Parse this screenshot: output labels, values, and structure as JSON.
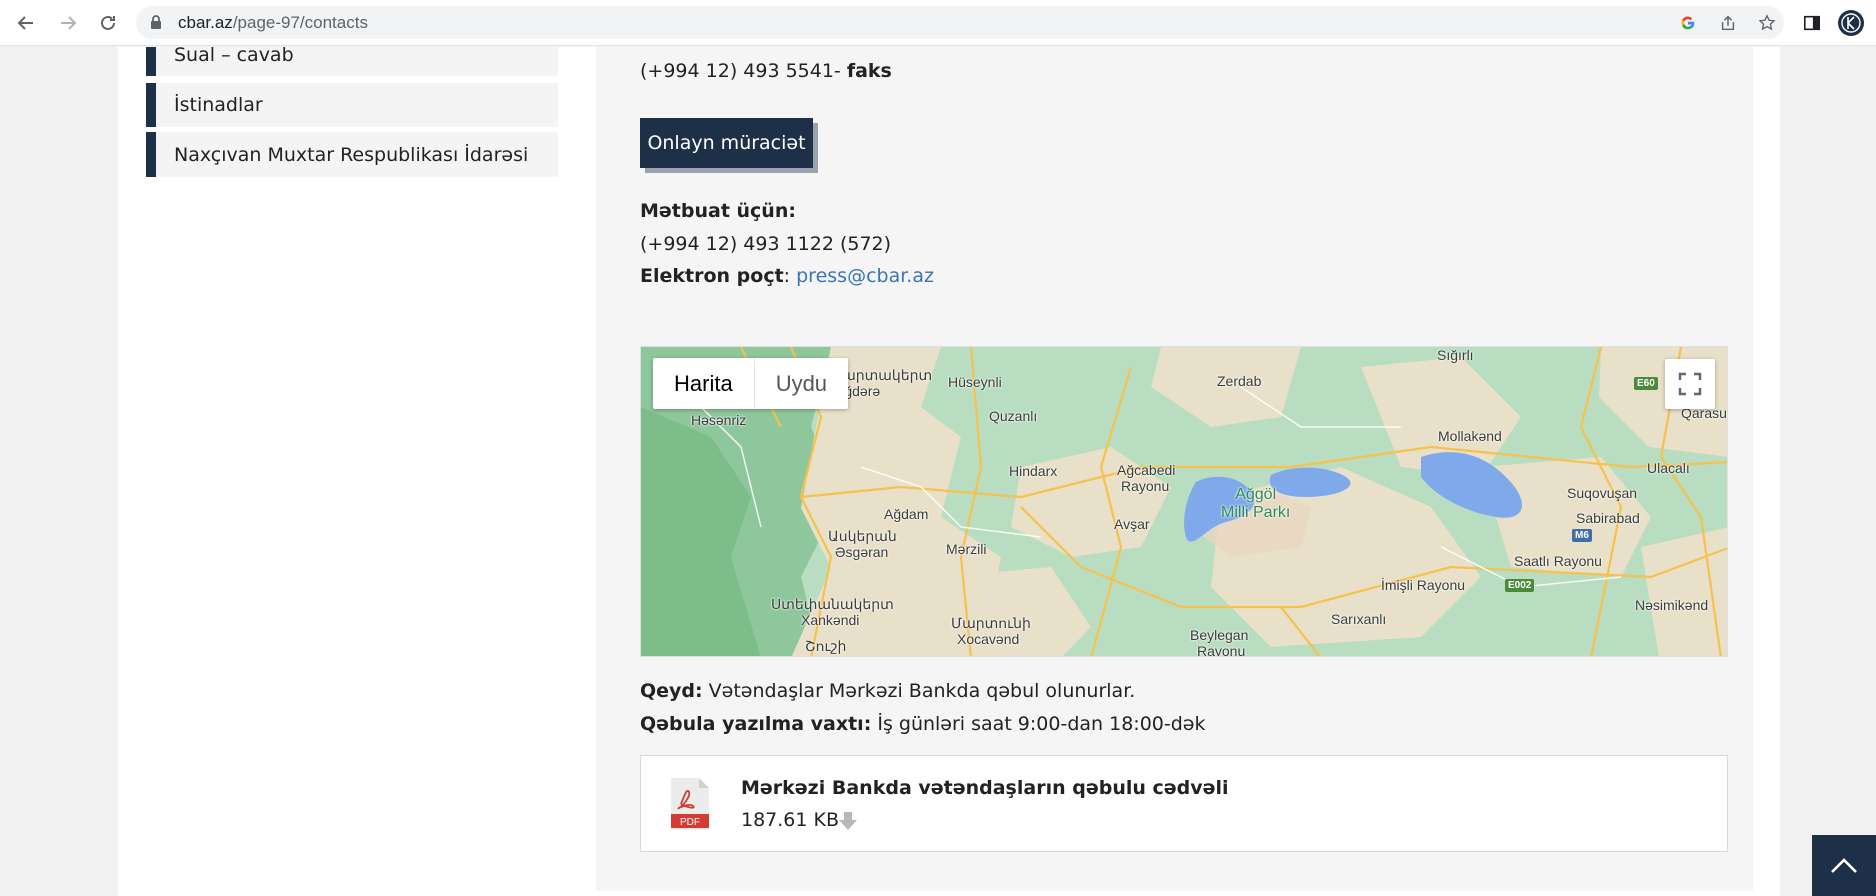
{
  "browser": {
    "url_host": "cbar.az",
    "url_path": "/page-97/contacts"
  },
  "sidebar": {
    "items": [
      {
        "label": "Sual – cavab"
      },
      {
        "label": "İstinadlar"
      },
      {
        "label": "Naxçıvan Muxtar Respublikası İdarəsi"
      }
    ]
  },
  "contacts": {
    "fax_number": "(+994 12) 493 5541-",
    "fax_label": "faks",
    "online_button": "Onlayn müraciət",
    "press_heading": "Mətbuat üçün:",
    "press_phone": "(+994 12) 493 1122 (572)",
    "email_label": "Elektron poçt",
    "email_sep": ":",
    "email_value": "press@cbar.az"
  },
  "map": {
    "tab_map": "Harita",
    "tab_satellite": "Uydu",
    "labels": {
      "sigirli": "Sığırlı",
      "zerdab": "Zerdab",
      "huseynli": "Hüseynli",
      "quzanli": "Quzanlı",
      "aghjabedi1": "Ağcabedi",
      "aghjabedi2": "Rayonu",
      "hindarx": "Hindarx",
      "aghdam": "Ağdam",
      "askeran_arm": "Ասկերան",
      "askeran": "Əsgəran",
      "merzili": "Mərzili",
      "avshar": "Avşar",
      "xankendi_arm": "Ստեփանակերտ",
      "xankendi": "Xankəndi",
      "xocavend_arm": "Մարտունի",
      "xocavend": "Xocavənd",
      "shushi_arm": "Շուշի",
      "hesenriz": "Həsənriz",
      "agdere_arm": "Մարտակերտ",
      "agdere": "Ağdərə",
      "beylegan1": "Beylegan",
      "beylegan2": "Rayonu",
      "sarixanli": "Sarıxanlı",
      "imishli": "İmişli Rayonu",
      "saatli": "Saatlı Rayonu",
      "nesimikend": "Nəsimikənd",
      "sabirabad": "Sabirabad",
      "suqovushan": "Suqovuşan",
      "ulacali": "Ulacalı",
      "mollakend": "Mollakənd",
      "qarasu": "Qarasu",
      "park1": "Ağgöl",
      "park2": "Milli Parkı"
    },
    "badges": {
      "e60": "E60",
      "m6": "M6",
      "e002": "E002"
    }
  },
  "notes": {
    "note_label": "Qeyd:",
    "note_text": "Vətəndaşlar Mərkəzi Bankda qəbul olunurlar.",
    "hours_label": "Qəbula yazılma vaxtı:",
    "hours_text": "İş günləri saat 9:00-dan 18:00-dək"
  },
  "document": {
    "icon_text": "PDF",
    "title": "Mərkəzi Bankda vətəndaşların qəbulu cədvəli",
    "size": "187.61 KB"
  },
  "colors": {
    "brand_navy": "#1d3047",
    "link_blue": "#3b74b8"
  }
}
